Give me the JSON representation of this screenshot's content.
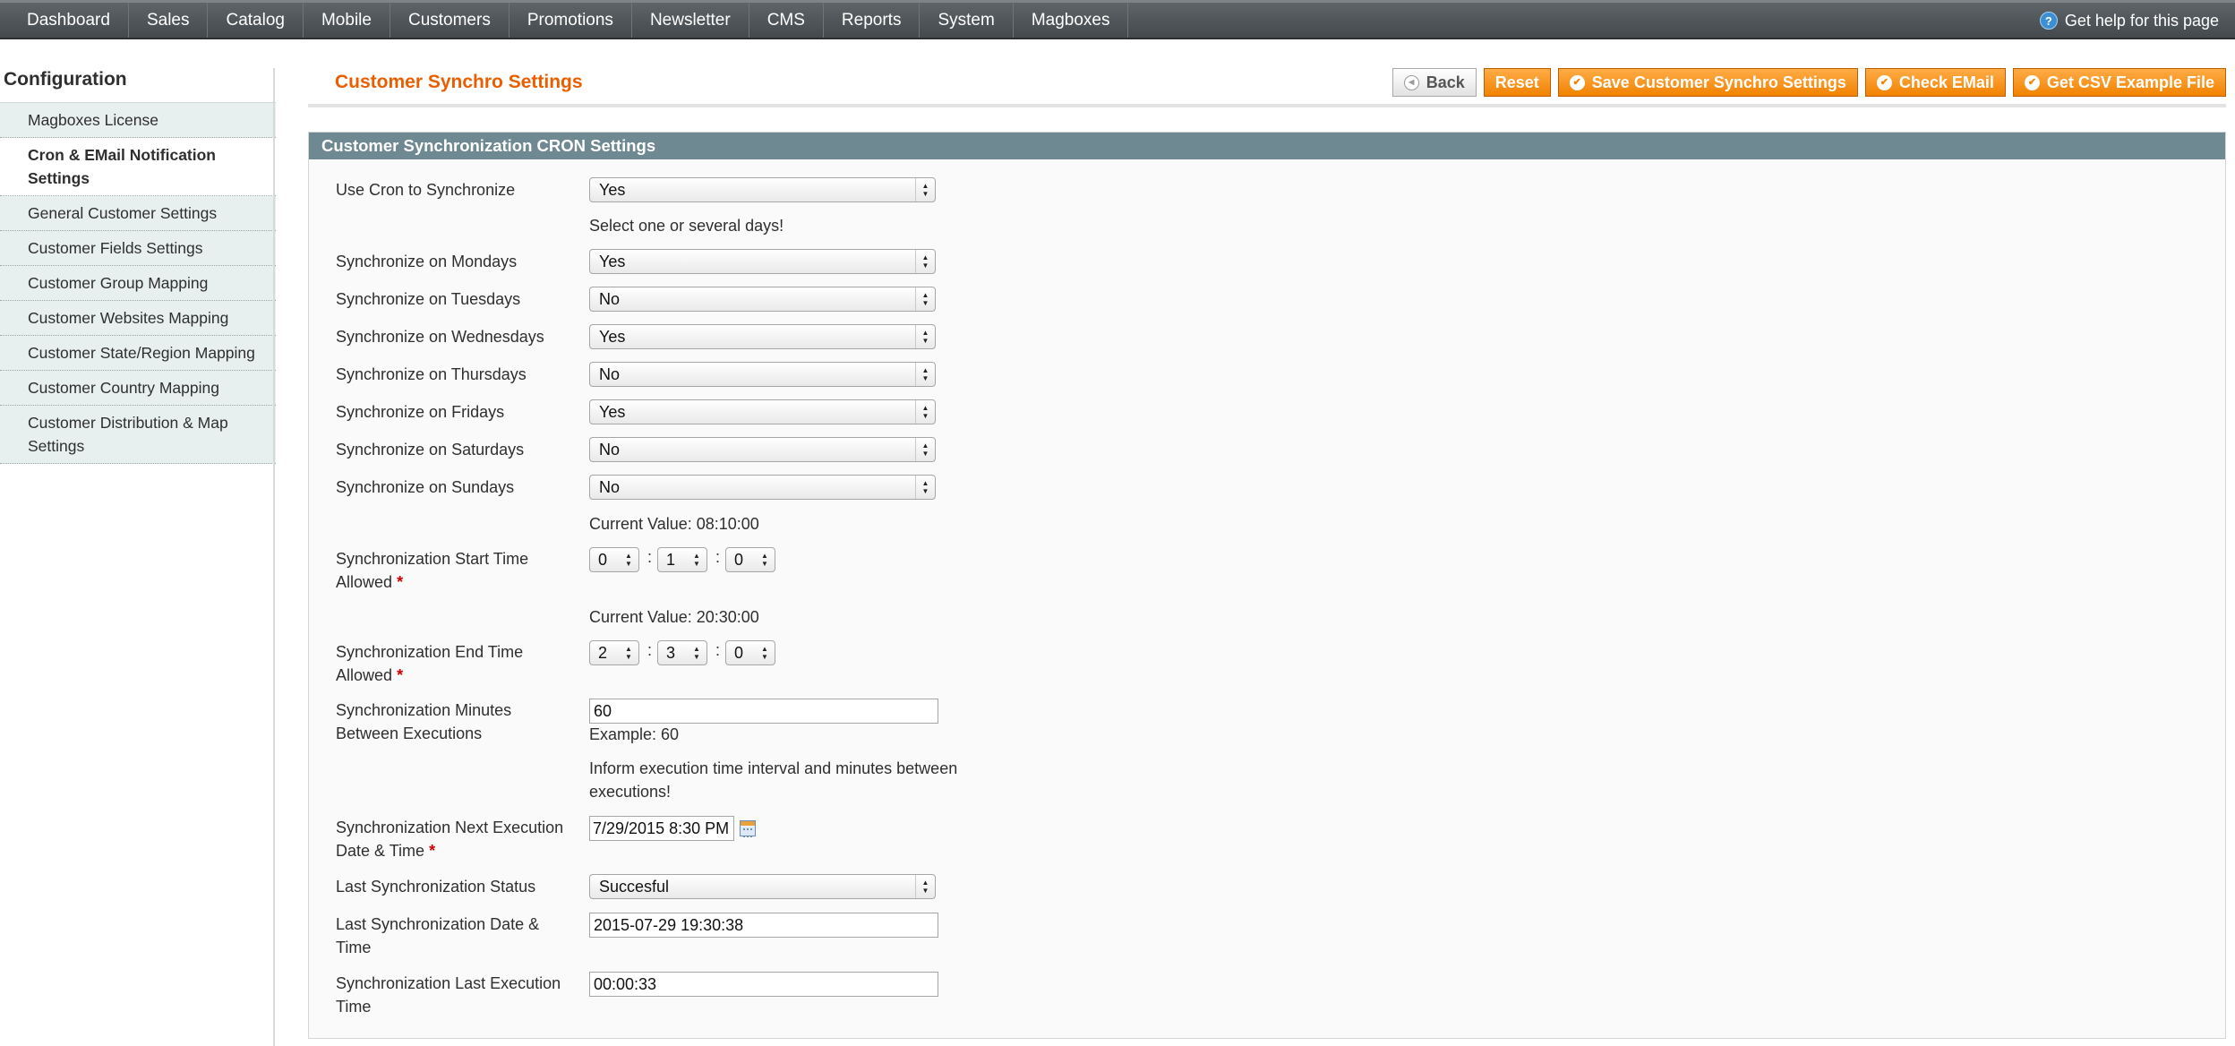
{
  "topnav": {
    "items": [
      "Dashboard",
      "Sales",
      "Catalog",
      "Mobile",
      "Customers",
      "Promotions",
      "Newsletter",
      "CMS",
      "Reports",
      "System",
      "Magboxes"
    ],
    "help": "Get help for this page"
  },
  "sidebar": {
    "title": "Configuration",
    "items": [
      "Magboxes License",
      "Cron & EMail Notification Settings",
      "General Customer Settings",
      "Customer Fields Settings",
      "Customer Group Mapping",
      "Customer Websites Mapping",
      "Customer State/Region Mapping",
      "Customer Country Mapping",
      "Customer Distribution & Map Settings"
    ],
    "active_index": 1
  },
  "header": {
    "title": "Customer Synchro Settings",
    "buttons": {
      "back": "Back",
      "reset": "Reset",
      "save": "Save Customer Synchro Settings",
      "check_email": "Check EMail",
      "csv": "Get CSV Example File"
    }
  },
  "section": {
    "title": "Customer Synchronization CRON Settings",
    "use_cron": {
      "label": "Use Cron to Synchronize",
      "value": "Yes"
    },
    "days_note": "Select one or several days!",
    "days": [
      {
        "label": "Synchronize on Mondays",
        "value": "Yes"
      },
      {
        "label": "Synchronize on Tuesdays",
        "value": "No"
      },
      {
        "label": "Synchronize on Wednesdays",
        "value": "Yes"
      },
      {
        "label": "Synchronize on Thursdays",
        "value": "No"
      },
      {
        "label": "Synchronize on Fridays",
        "value": "Yes"
      },
      {
        "label": "Synchronize on Saturdays",
        "value": "No"
      },
      {
        "label": "Synchronize on Sundays",
        "value": "No"
      }
    ],
    "start_time": {
      "current": "Current Value: 08:10:00",
      "label": "Synchronization Start Time Allowed",
      "required": "*",
      "hour": "0",
      "minute": "1",
      "second": "0"
    },
    "end_time": {
      "current": "Current Value: 20:30:00",
      "label": "Synchronization End Time Allowed",
      "required": "*",
      "hour": "2",
      "minute": "3",
      "second": "0"
    },
    "minutes": {
      "label": "Synchronization Minutes Between Executions",
      "value": "60",
      "example": "Example: 60",
      "hint": "Inform execution time interval and minutes between executions!"
    },
    "next_exec": {
      "label": "Synchronization Next Execution Date & Time",
      "required": "*",
      "value": "7/29/2015 8:30 PM"
    },
    "last_status": {
      "label": "Last Synchronization Status",
      "value": "Succesful"
    },
    "last_date": {
      "label": "Last Synchronization Date & Time",
      "value": "2015-07-29 19:30:38"
    },
    "last_exec_time": {
      "label": "Synchronization Last Execution Time",
      "value": "00:00:33"
    },
    "time_separator": ":"
  },
  "icons": {
    "help": "help-icon",
    "back": "back-icon",
    "check": "check-circle-icon",
    "calendar": "calendar-icon",
    "select_arrows": "select-arrows-icon"
  },
  "colors": {
    "title_orange": "#eb5e00",
    "button_orange": "#f18200",
    "section_header": "#6f8992",
    "required_red": "#d00000"
  }
}
